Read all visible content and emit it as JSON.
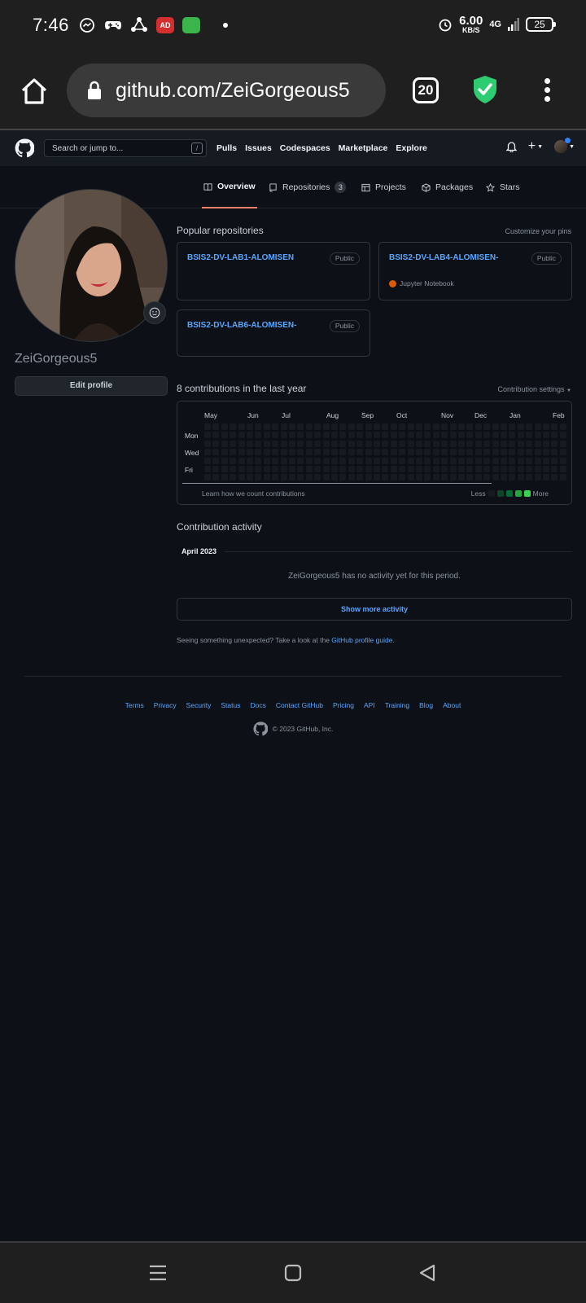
{
  "statusbar": {
    "time": "7:46",
    "net_speed": "6.00",
    "net_unit": "KB/S",
    "signal": "4G",
    "battery": "25",
    "notification_icons": [
      "messenger-icon",
      "gamepad-icon",
      "share-icon",
      "adblock-icon",
      "store-icon"
    ]
  },
  "browser": {
    "url": "github.com/ZeiGorgeous5",
    "tab_count": "20"
  },
  "gh_header": {
    "search_placeholder": "Search or jump to...",
    "search_shortcut": "/",
    "nav": [
      "Pulls",
      "Issues",
      "Codespaces",
      "Marketplace",
      "Explore"
    ],
    "plus": "+"
  },
  "tabs": {
    "overview": "Overview",
    "repositories": "Repositories",
    "repositories_count": "3",
    "projects": "Projects",
    "packages": "Packages",
    "stars": "Stars"
  },
  "profile": {
    "username": "ZeiGorgeous5",
    "edit_button": "Edit profile"
  },
  "popular": {
    "title": "Popular repositories",
    "customize": "Customize your pins",
    "repos": [
      {
        "name": "BSIS2-DV-LAB1-ALOMISEN",
        "visibility": "Public",
        "language": ""
      },
      {
        "name": "BSIS2-DV-LAB4-ALOMISEN-",
        "visibility": "Public",
        "language": "Jupyter Notebook"
      },
      {
        "name": "BSIS2-DV-LAB6-ALOMISEN-",
        "visibility": "Public",
        "language": ""
      }
    ],
    "language_color": "#da5b0b"
  },
  "contributions": {
    "title": "8 contributions in the last year",
    "settings": "Contribution settings",
    "months": [
      "May",
      "Jun",
      "Jul",
      "Aug",
      "Sep",
      "Oct",
      "Nov",
      "Dec",
      "Jan",
      "Feb"
    ],
    "days": [
      "Mon",
      "Wed",
      "Fri"
    ],
    "learn": "Learn how we count contributions",
    "less": "Less",
    "more": "More",
    "legend_colors": [
      "#161b22",
      "#0e4429",
      "#006d32",
      "#26a641",
      "#39d353"
    ]
  },
  "activity": {
    "title": "Contribution activity",
    "month": "April 2023",
    "empty": "ZeiGorgeous5 has no activity yet for this period.",
    "show_more": "Show more activity",
    "unexpected": "Seeing something unexpected? Take a look at the",
    "guide_link": "GitHub profile guide."
  },
  "footer": {
    "links": [
      "Terms",
      "Privacy",
      "Security",
      "Status",
      "Docs",
      "Contact GitHub",
      "Pricing",
      "API",
      "Training",
      "Blog",
      "About"
    ],
    "copyright": "© 2023 GitHub, Inc."
  },
  "colors": {
    "bg": "#0d1117",
    "link": "#58a6ff",
    "active_tab": "#f78166",
    "shield": "#2ecc71"
  }
}
